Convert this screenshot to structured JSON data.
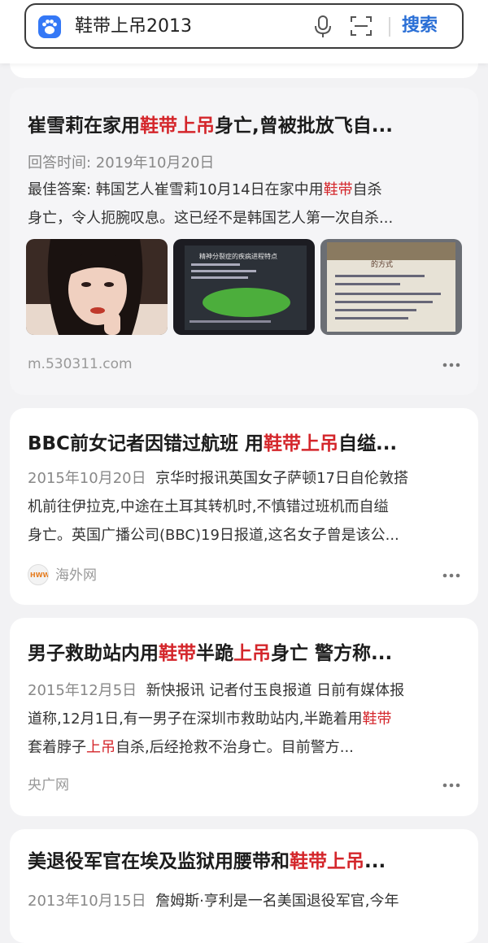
{
  "search": {
    "query": "鞋带上吊2013",
    "button_label": "搜索"
  },
  "results": [
    {
      "title_parts": [
        "崔雪莉在家用",
        "鞋带上吊",
        "身亡,曾被批放飞自..."
      ],
      "answer_time": "回答时间: 2019年10月20日",
      "best_answer_prefix": "最佳答案:",
      "line1_parts": [
        " 韩国艺人崔雪莉10月14日在家中用",
        "鞋带",
        "自杀"
      ],
      "line2": "身亡，令人扼腕叹息。这已经不是韩国艺人第一次自杀...",
      "images": [
        "portrait-photo",
        "presentation-slide-green",
        "presentation-slide-treatment"
      ],
      "slide_title": "精神分裂症的疾病进程特点",
      "slide2_title": "的方式",
      "source": "m.530311.com"
    },
    {
      "title_parts": [
        "BBC前女记者因错过航班 用",
        "鞋带上吊",
        "自缢..."
      ],
      "date": "2015年10月20日",
      "line1_rest": "京华时报讯英国女子萨顿17日自伦敦搭",
      "line2": "机前往伊拉克,中途在土耳其转机时,不慎错过班机而自缢",
      "line3": "身亡。英国广播公司(BBC)19日报道,这名女子曾是该公...",
      "source": "海外网",
      "source_logo": "HWW"
    },
    {
      "title_parts": [
        "男子救助站内用",
        "鞋带",
        "半跪",
        "上吊",
        "身亡 警方称..."
      ],
      "date": "2015年12月5日",
      "line1_rest": "新快报讯 记者付玉良报道 日前有媒体报",
      "line2_parts": [
        "道称,12月1日,有一男子在深圳市救助站内,半跪着用",
        "鞋带"
      ],
      "line3_parts": [
        "套着脖子",
        "上吊",
        "自杀,后经抢救不治身亡。目前警方..."
      ],
      "source": "央广网"
    },
    {
      "title_parts": [
        "美退役军官在埃及监狱用腰带和",
        "鞋带上吊",
        "..."
      ],
      "date": "2013年10月15日",
      "line1_rest": "詹姆斯·亨利是一名美国退役军官,今年"
    }
  ],
  "colors": {
    "highlight": "#d4262b",
    "accent": "#2a6fd6",
    "background": "#f2f2f4"
  }
}
